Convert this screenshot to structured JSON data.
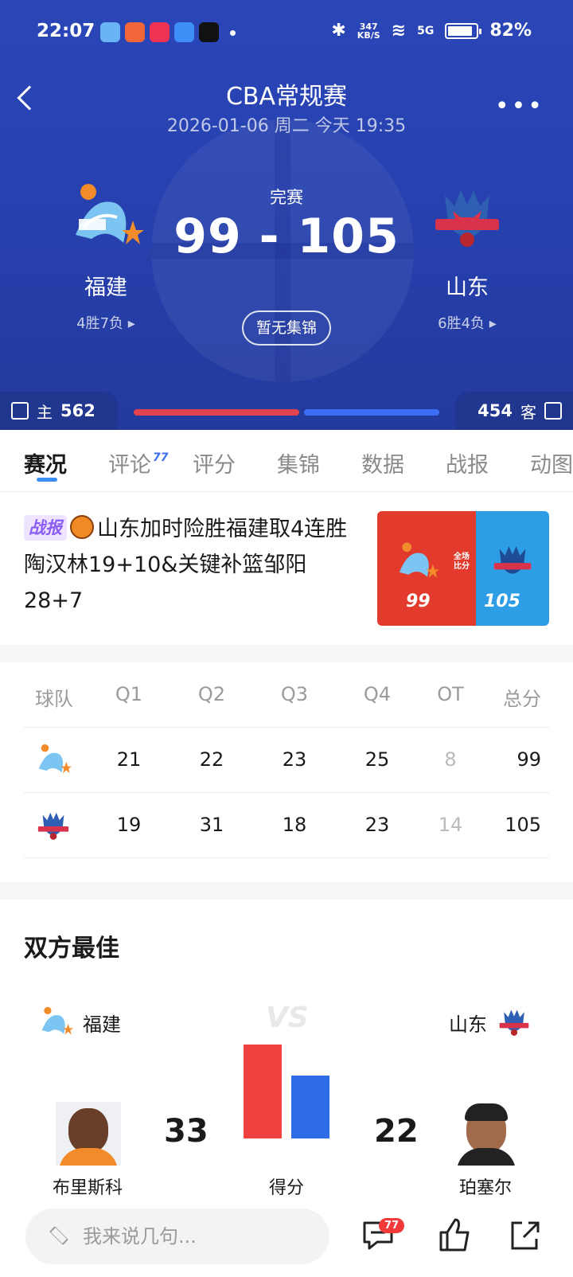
{
  "status_bar": {
    "time": "22:07",
    "net_speed": "347",
    "net_unit": "KB/S",
    "signal": "5G",
    "battery": "82%"
  },
  "header": {
    "league": "CBA常规赛",
    "date": "2026-01-06 周二 今天 19:35",
    "game_status": "完赛",
    "score": "99 - 105",
    "highlights_btn": "暂无集锦"
  },
  "home": {
    "name": "福建",
    "record": "4胜7负 ▸",
    "likes_label": "主",
    "likes": "562",
    "color": "#e3434c"
  },
  "away": {
    "name": "山东",
    "record": "6胜4负 ▸",
    "likes_label": "客",
    "likes": "454",
    "color": "#3b6ef5"
  },
  "like_share": {
    "home": 0.553,
    "away": 0.447
  },
  "tabs": [
    {
      "label": "赛况",
      "active": true
    },
    {
      "label": "评论",
      "badge": "77"
    },
    {
      "label": "评分"
    },
    {
      "label": "集锦"
    },
    {
      "label": "数据"
    },
    {
      "label": "战报"
    },
    {
      "label": "动图"
    }
  ],
  "news": {
    "tag": "战报",
    "headline": "山东加时险胜福建取4连胜 陶汉林19+10&关键补篮邹阳28+7",
    "image_home_score": "99",
    "image_away_score": "105",
    "image_center_text": "全场\n比分"
  },
  "score_table": {
    "headers": [
      "球队",
      "Q1",
      "Q2",
      "Q3",
      "Q4",
      "OT",
      "总分"
    ],
    "rows": [
      {
        "team": "福建",
        "q": [
          "21",
          "22",
          "23",
          "25",
          "8",
          "99"
        ]
      },
      {
        "team": "山东",
        "q": [
          "19",
          "31",
          "18",
          "23",
          "14",
          "105"
        ]
      }
    ]
  },
  "best": {
    "title": "双方最佳",
    "home_team": "福建",
    "away_team": "山东",
    "vs": "VS",
    "home_player": "布里斯科",
    "away_player": "珀塞尔",
    "home_value": 33,
    "away_value": 22,
    "stat": "得分"
  },
  "bottom": {
    "input_placeholder": "我来说几句...",
    "comment_count": "77"
  }
}
